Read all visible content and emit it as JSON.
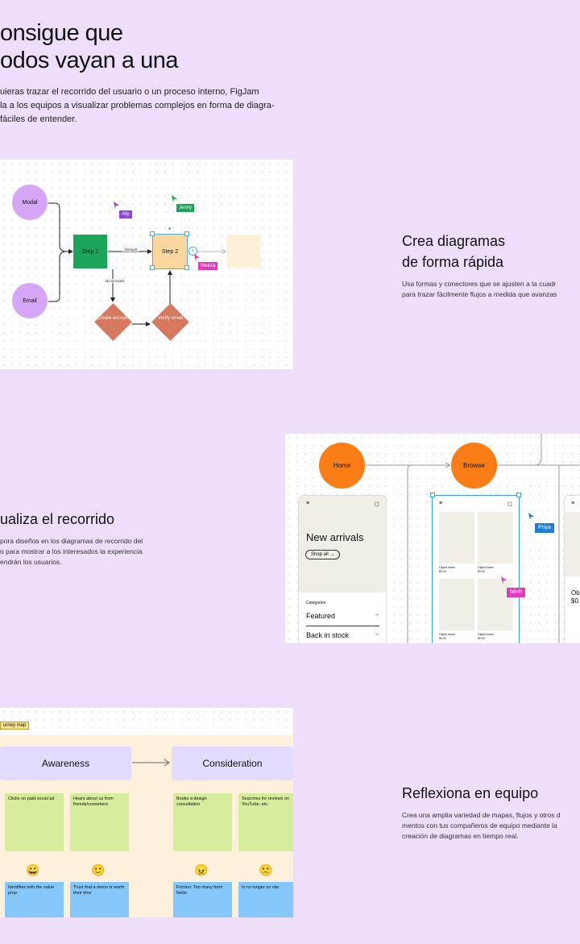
{
  "hero": {
    "title_line1": "onsigue que",
    "title_line2": "odos vayan a una",
    "body_line1": "uieras trazar el recorrido del usuario o un proceso interno, FigJam",
    "body_line2": "la a los equipos a visualizar problemas complejos en forma de diagra-",
    "body_line3": "fáciles de entender."
  },
  "section1": {
    "title_line1": "Crea diagramas",
    "title_line2": "de forma rápida",
    "body_line1": "Usa formas y conectores que se ajusten a la cuadr",
    "body_line2": "para trazar fácilmente flujos a medida que avanzas",
    "diagram": {
      "modal": "Modal",
      "email": "Email",
      "step1": "Step 1",
      "step2": "Step 2",
      "account_label": "Account",
      "no_account_label": "No account",
      "create_account": "Create account",
      "verify_email": "Verify email",
      "cursor_ally": "Ally",
      "cursor_jenny": "Jenny",
      "cursor_meeza": "Meeza"
    }
  },
  "section2": {
    "title": "ualiza el recorrido",
    "body_line1": "pora diseños en los diagramas de recorrido del",
    "body_line2": "o para mostrar a los interesados la experiencia",
    "body_line3": "endrán los usuarios.",
    "flow": {
      "home": "Home",
      "browse": "Browse",
      "new_arrivals": "New arrivals",
      "shop_all": "Shop all →",
      "categories": "Categories",
      "featured": "Featured",
      "back_in_stock": "Back in stock",
      "arrow": "→",
      "object_name": "Object name",
      "price": "$0.00",
      "cursor_priya": "Priya",
      "cursor_minh": "Minh",
      "partial_ob": "Ob",
      "partial_price": "$0."
    }
  },
  "section3": {
    "title": "Reflexiona en equipo",
    "body_line1": "Crea una amplia variedad de mapas, flujos y otros d",
    "body_line2": "mentos con tus compañeros de equipo mediante la",
    "body_line3": "creación de diagramas en tiempo real.",
    "journey": {
      "label": "urney map",
      "awareness": "Awareness",
      "consideration": "Consideration",
      "notes": [
        "Clicks on paid social ad",
        "Hears about us from friends/coworkers",
        "Books a design consultation",
        "Searches for reviews on YouTube, etc."
      ],
      "emojis": [
        "😀",
        "🙂",
        "😠",
        "🙁"
      ],
      "insights": [
        "Identifies with the value prop",
        "Trust that a demo is worth their time",
        "Friction: Too many form fields",
        "Is no longer on site"
      ]
    }
  },
  "colors": {
    "background": "#eddffc",
    "purple_circle": "#d6a6f6",
    "step_green": "#1ca55a",
    "step_yellow": "#fbd7a0",
    "diamond": "#d5785d",
    "orange": "#fa7d15",
    "note_green": "#d6eb9c",
    "note_blue": "#85c7fa",
    "stage_purple": "#e4dcfe"
  }
}
